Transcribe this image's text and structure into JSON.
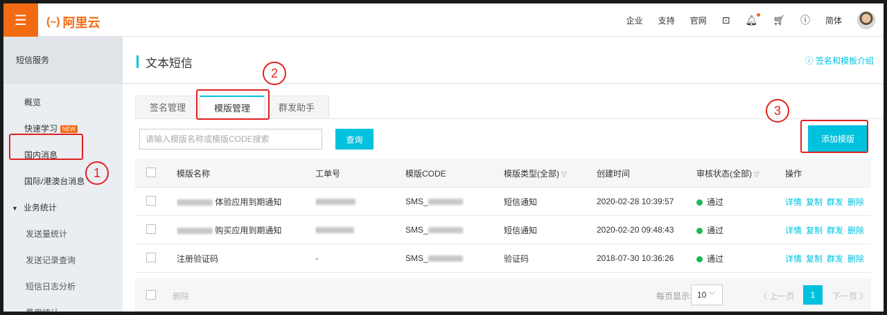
{
  "topbar": {
    "menu_icon": "menu-icon",
    "logo_text": "阿里云",
    "nav": [
      "企业",
      "支持",
      "官网"
    ],
    "lang": "简体"
  },
  "sidebar": {
    "title": "短信服务",
    "items": [
      {
        "label": "概览"
      },
      {
        "label": "快速学习",
        "badge": "NEW"
      },
      {
        "label": "国内消息"
      },
      {
        "label": "国际/港澳台消息"
      }
    ],
    "group": "业务统计",
    "sub_items": [
      "发送量统计",
      "发送记录查询",
      "短信日志分析",
      "费用统计"
    ]
  },
  "page": {
    "title": "文本短信",
    "help_link": "签名和模板介绍"
  },
  "tabs": [
    "签名管理",
    "模版管理",
    "群发助手"
  ],
  "search": {
    "placeholder": "请输入模版名称或模版CODE搜索",
    "button": "查询"
  },
  "add_button": "添加模版",
  "table": {
    "headers": {
      "name": "模版名称",
      "no": "工单号",
      "code": "模版CODE",
      "type": "模版类型(全部)",
      "time": "创建时间",
      "status": "审核状态(全部)",
      "ops": "操作"
    },
    "rows": [
      {
        "name": "体验应用到期通知",
        "no": "",
        "code": "SMS_",
        "type": "短信通知",
        "time": "2020-02-28 10:39:57",
        "status": "通过"
      },
      {
        "name": "购买应用到期通知",
        "no": "",
        "code": "SMS_",
        "type": "短信通知",
        "time": "2020-02-20 09:48:43",
        "status": "通过"
      },
      {
        "name": "注册验证码",
        "no": "-",
        "code": "SMS_",
        "type": "验证码",
        "time": "2018-07-30 10:36:26",
        "status": "通过"
      }
    ],
    "ops": [
      "详情",
      "复制",
      "群发",
      "删除"
    ]
  },
  "footer": {
    "delete": "删除",
    "per_page_label": "每页显示:",
    "per_page_value": "10",
    "prev": "上一页",
    "current_page": "1",
    "next": "下一页"
  },
  "annotations": [
    "1",
    "2",
    "3"
  ],
  "colors": {
    "accent": "#00c1de",
    "brand": "#f26b12",
    "annotation": "#e02020",
    "status_ok": "#1db954"
  }
}
